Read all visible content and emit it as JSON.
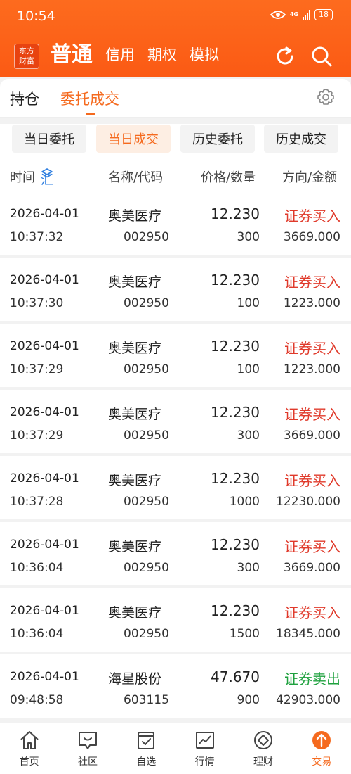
{
  "status_bar": {
    "time": "10:54",
    "network": "4G",
    "battery": "18"
  },
  "header": {
    "logo_line1": "东方",
    "logo_line2": "财富",
    "modes": [
      "普通",
      "信用",
      "期权",
      "模拟"
    ],
    "active_mode": "普通",
    "icons": [
      "refresh-icon",
      "search-icon"
    ]
  },
  "top_tabs": [
    "持仓",
    "委托成交"
  ],
  "active_top_tab": "委托成交",
  "sub_tabs": [
    "当日委托",
    "当日成交",
    "历史委托",
    "历史成交"
  ],
  "active_sub_tab": "当日成交",
  "columns": {
    "time": "时间",
    "summary": "汇总",
    "name": "名称/代码",
    "price": "价格/数量",
    "direction": "方向/金额"
  },
  "trades": [
    {
      "date": "2026-04-01",
      "time": "10:37:32",
      "name": "奥美医疗",
      "code": "002950",
      "price": "12.230",
      "qty": "300",
      "direction": "证券买入",
      "amount": "3669.000"
    },
    {
      "date": "2026-04-01",
      "time": "10:37:30",
      "name": "奥美医疗",
      "code": "002950",
      "price": "12.230",
      "qty": "100",
      "direction": "证券买入",
      "amount": "1223.000"
    },
    {
      "date": "2026-04-01",
      "time": "10:37:29",
      "name": "奥美医疗",
      "code": "002950",
      "price": "12.230",
      "qty": "100",
      "direction": "证券买入",
      "amount": "1223.000"
    },
    {
      "date": "2026-04-01",
      "time": "10:37:29",
      "name": "奥美医疗",
      "code": "002950",
      "price": "12.230",
      "qty": "300",
      "direction": "证券买入",
      "amount": "3669.000"
    },
    {
      "date": "2026-04-01",
      "time": "10:37:28",
      "name": "奥美医疗",
      "code": "002950",
      "price": "12.230",
      "qty": "1000",
      "direction": "证券买入",
      "amount": "12230.000"
    },
    {
      "date": "2026-04-01",
      "time": "10:36:04",
      "name": "奥美医疗",
      "code": "002950",
      "price": "12.230",
      "qty": "300",
      "direction": "证券买入",
      "amount": "3669.000"
    },
    {
      "date": "2026-04-01",
      "time": "10:36:04",
      "name": "奥美医疗",
      "code": "002950",
      "price": "12.230",
      "qty": "1500",
      "direction": "证券买入",
      "amount": "18345.000"
    },
    {
      "date": "2026-04-01",
      "time": "09:48:58",
      "name": "海星股份",
      "code": "603115",
      "price": "47.670",
      "qty": "900",
      "direction": "证券卖出",
      "amount": "42903.000"
    }
  ],
  "bottom_nav": [
    {
      "label": "首页",
      "icon": "home-icon"
    },
    {
      "label": "社区",
      "icon": "community-icon"
    },
    {
      "label": "自选",
      "icon": "watchlist-icon"
    },
    {
      "label": "行情",
      "icon": "market-icon"
    },
    {
      "label": "理财",
      "icon": "wealth-icon"
    },
    {
      "label": "交易",
      "icon": "trade-icon"
    }
  ],
  "active_nav": "交易",
  "colors": {
    "accent": "#f56a1e",
    "buy": "#e03a2b",
    "sell": "#1ea13e",
    "header": "#fb5a14"
  }
}
